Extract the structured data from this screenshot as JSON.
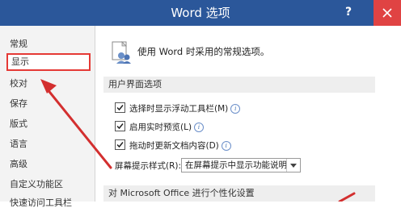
{
  "window": {
    "title": "Word 选项",
    "help_label": "?",
    "accent_color": "#2b579a",
    "close_color": "#e04343"
  },
  "sidebar": {
    "items": [
      {
        "label": "常规"
      },
      {
        "label": "显示",
        "selected": true
      },
      {
        "label": "校对"
      },
      {
        "label": "保存"
      },
      {
        "label": "版式"
      },
      {
        "label": "语言"
      },
      {
        "label": "高级"
      },
      {
        "label": "自定义功能区"
      },
      {
        "label": "快速访问工具栏"
      }
    ]
  },
  "main": {
    "intro_text": "使用 Word 时采用的常规选项。",
    "ui_section": {
      "title": "用户界面选项",
      "options": [
        {
          "label": "选择时显示浮动工具栏(M)",
          "checked": true
        },
        {
          "label": "启用实时预览(L)",
          "checked": true
        },
        {
          "label": "拖动时更新文档内容(D)",
          "checked": true
        }
      ],
      "screentip_label": "屏幕提示样式(R):",
      "screentip_value": "在屏幕提示中显示功能说明"
    },
    "personalize_section": {
      "title": "对 Microsoft Office 进行个性化设置"
    }
  },
  "annotation": {
    "arrow_color": "#d32f2f"
  }
}
